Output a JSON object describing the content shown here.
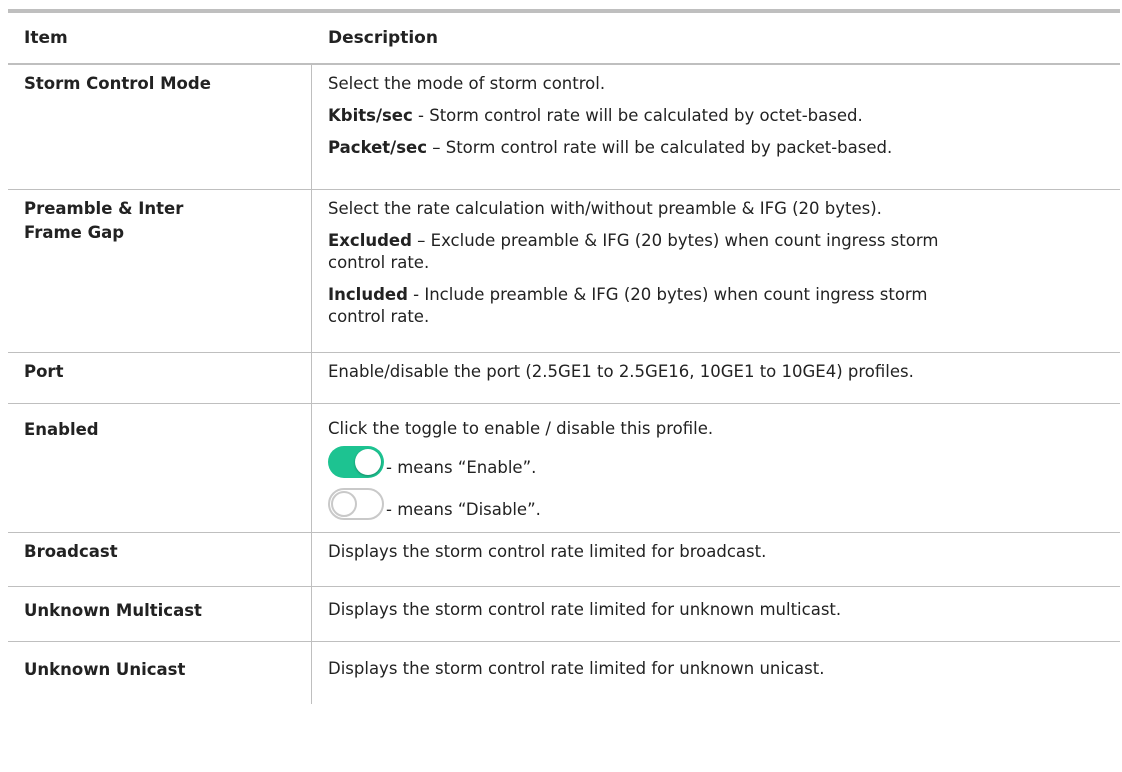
{
  "header": {
    "item": "Item",
    "description": "Description"
  },
  "rows": [
    {
      "item": "Storm Control Mode",
      "lines": [
        {
          "bold": "",
          "text": "Select the mode of storm control."
        },
        {
          "bold": "Kbits/sec",
          "text": " - Storm control rate will be calculated by octet-based."
        },
        {
          "bold": "Packet/sec",
          "text": " – Storm control rate will be calculated by packet-based."
        }
      ]
    },
    {
      "item": "Preamble & Inter Frame Gap",
      "lines": [
        {
          "bold": "",
          "text": "Select the rate calculation with/without preamble & IFG (20 bytes)."
        },
        {
          "bold": "Excluded",
          "text": " – Exclude preamble & IFG (20 bytes) when count ingress storm control rate."
        },
        {
          "bold": "Included",
          "text": " - Include preamble & IFG (20 bytes) when count ingress storm control rate."
        }
      ]
    },
    {
      "item": "Port",
      "lines": [
        {
          "bold": "",
          "text": "Enable/disable the port (2.5GE1 to 2.5GE16, 10GE1 to 10GE4) profiles."
        }
      ]
    },
    {
      "item": "Enabled",
      "intro": "Click the toggle to enable / disable this profile.",
      "toggle_on_text": " - means “Enable”.",
      "toggle_off_text": " - means “Disable”."
    },
    {
      "item": "Broadcast",
      "lines": [
        {
          "bold": "",
          "text": "Displays the storm control rate limited for broadcast."
        }
      ]
    },
    {
      "item": "Unknown Multicast",
      "lines": [
        {
          "bold": "",
          "text": "Displays the storm control rate limited for unknown multicast."
        }
      ]
    },
    {
      "item": "Unknown Unicast",
      "lines": [
        {
          "bold": "",
          "text": "Displays the storm control rate limited for unknown unicast."
        }
      ]
    }
  ],
  "colors": {
    "toggle_on": "#1dc391",
    "toggle_off_border": "#c9c9c9",
    "rule": "#bfbfbf"
  },
  "icons": {
    "toggle_on": "toggle-on-icon",
    "toggle_off": "toggle-off-icon"
  }
}
